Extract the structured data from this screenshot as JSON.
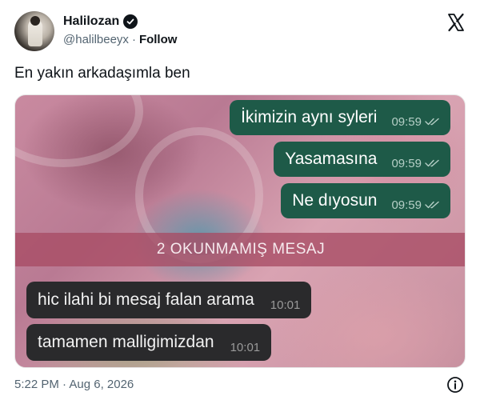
{
  "author": {
    "display_name": "Halilozan",
    "handle": "@halilbeeyx",
    "separator": "·",
    "follow_label": "Follow"
  },
  "tweet": {
    "text": "En yakın arkadaşımla ben",
    "timestamp": "5:22 PM · Aug 6, 2026"
  },
  "chat": {
    "outgoing": [
      {
        "text": "İkimizin aynı syleri",
        "time": "09:59"
      },
      {
        "text": "Yasamasına",
        "time": "09:59"
      },
      {
        "text": "Ne dıyosun",
        "time": "09:59"
      }
    ],
    "unread_banner": "2 OKUNMAMIŞ MESAJ",
    "incoming": [
      {
        "text": "hic ilahi bi mesaj falan arama",
        "time": "10:01"
      },
      {
        "text": "tamamen malligimizdan",
        "time": "10:01"
      }
    ]
  },
  "icons": {
    "verified": "verified-badge-icon",
    "brand": "x-logo-icon",
    "info": "info-icon",
    "read": "double-check-icon"
  },
  "colors": {
    "outgoing_bubble": "#1e5a48",
    "incoming_bubble": "#2a2a2c",
    "unread_banner": "#a84b64",
    "muted_text": "#536471"
  }
}
